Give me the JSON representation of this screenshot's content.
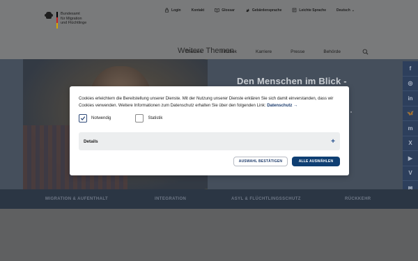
{
  "logo": {
    "text_line1": "Bundesamt",
    "text_line2": "für Migration",
    "text_line3": "und Flüchtlinge"
  },
  "meta_nav": {
    "login": "Login",
    "contact": "Kontakt",
    "glossary": "Glossar",
    "sign_language": "Gebärdensprache",
    "easy_language": "Leichte Sprache",
    "language": "Deutsch"
  },
  "main_nav": [
    "Themen",
    "Infothek",
    "Karriere",
    "Presse",
    "Behörde"
  ],
  "hero": {
    "title": "Den Menschen im Blick -"
  },
  "social": [
    "f",
    "◎",
    "in",
    "🦋",
    "m",
    "X",
    "▶",
    "V",
    "✉"
  ],
  "topics": [
    "MIGRATION & AUFENTHALT",
    "INTEGRATION",
    "ASYL & FLÜCHTLINGSSCHUTZ",
    "RÜCKKEHR"
  ],
  "below": {
    "title": "Weitere Themen"
  },
  "cookie_dialog": {
    "text": "Cookies erleichtern die Bereitstellung unserer Dienste. Mit der Nutzung unserer Dienste erklären Sie sich damit einverstanden, dass wir Cookies verwenden. Weitere Informationen zum Datenschutz erhalten Sie über den folgenden Link:",
    "link": "Datenschutz",
    "link_arrow": "→",
    "option_necessary": "Notwendig",
    "option_statistics": "Statistik",
    "details": "Details",
    "details_plus": "+",
    "confirm_button": "AUSWAHL BESTÄTIGEN",
    "select_all_button": "ALLE AUSWÄHLEN"
  },
  "colors": {
    "accent": "#0f3f73",
    "overlay": "#797a7b"
  }
}
